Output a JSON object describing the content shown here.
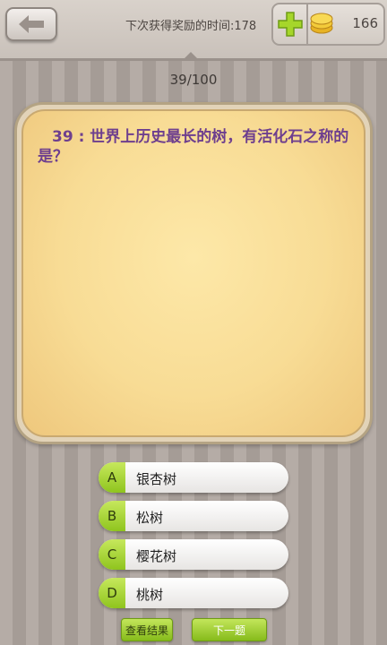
{
  "header": {
    "reward_label": "下次获得奖励的时间:178",
    "coins": "166"
  },
  "progress": "39/100",
  "question": {
    "text": "39 : 世界上历史最长的树，有活化石之称的是？"
  },
  "options": [
    {
      "letter": "A",
      "text": "银杏树"
    },
    {
      "letter": "B",
      "text": "松树"
    },
    {
      "letter": "C",
      "text": "樱花树"
    },
    {
      "letter": "D",
      "text": "桃树"
    }
  ],
  "buttons": {
    "view_results": "查看结果",
    "next": "下一题"
  },
  "icons": {
    "back": "back-arrow-icon",
    "plus": "plus-icon",
    "coin": "coin-icon"
  },
  "colors": {
    "accent_green": "#8fc41e",
    "question_text": "#6e3f8e"
  }
}
